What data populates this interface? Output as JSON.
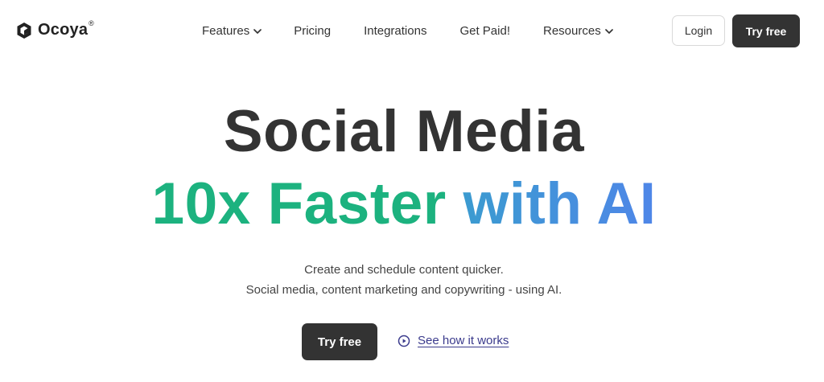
{
  "header": {
    "logo_text": "Ocoya",
    "logo_reg": "®",
    "nav": [
      {
        "label": "Features",
        "has_dropdown": true
      },
      {
        "label": "Pricing",
        "has_dropdown": false
      },
      {
        "label": "Integrations",
        "has_dropdown": false
      },
      {
        "label": "Get Paid!",
        "has_dropdown": false
      },
      {
        "label": "Resources",
        "has_dropdown": true
      }
    ],
    "login_label": "Login",
    "try_free_label": "Try free"
  },
  "hero": {
    "line1": "Social Media",
    "line2_part1": "10x Faster ",
    "line2_part2": "with AI",
    "subtitle_1": "Create and schedule content quicker.",
    "subtitle_2": "Social media, content marketing and copywriting - using AI.",
    "cta_label": "Try free",
    "secondary_label": "See how it works"
  },
  "colors": {
    "dark": "#333333",
    "green": "#1cb27f",
    "blue": "#4791e0",
    "link": "#3a3a8c"
  },
  "icons": {
    "logo": "cube-logo-icon",
    "dropdown": "chevron-down-icon",
    "play": "play-circle-icon"
  }
}
